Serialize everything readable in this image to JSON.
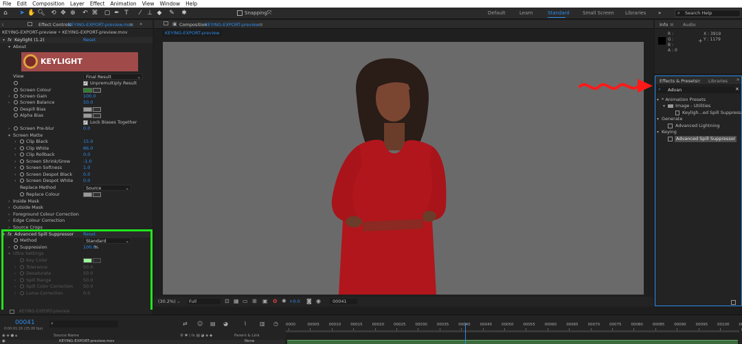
{
  "menu": [
    "File",
    "Edit",
    "Composition",
    "Layer",
    "Effect",
    "Animation",
    "View",
    "Window",
    "Help"
  ],
  "toolbar": {
    "snapping_label": "Snapping",
    "workspaces": [
      "Default",
      "Learn",
      "Standard",
      "Small Screen",
      "Libraries"
    ],
    "active_workspace": "Standard",
    "search_help_placeholder": "Search Help"
  },
  "effect_controls": {
    "tab_prefix": "Effect Controls",
    "tab_file": "KEYING-EXPORT-preview.mov",
    "breadcrumb": "KEYING-EXPORT-preview • KEYING-EXPORT-preview.mov",
    "keylight": {
      "name": "Keylight (1.2)",
      "reset": "Reset",
      "about": "About",
      "logo_text": "KEYLIGHT",
      "view_label": "View",
      "view_value": "Final Result",
      "unpremultiply": "Unpremultiply Result",
      "screen_colour": "Screen Colour",
      "screen_gain": {
        "label": "Screen Gain",
        "value": "100.0"
      },
      "screen_balance": {
        "label": "Screen Balance",
        "value": "50.0"
      },
      "despill_bias": "Despill Bias",
      "alpha_bias": "Alpha Bias",
      "lock_biases": "Lock Biases Together",
      "screen_preblur": {
        "label": "Screen Pre-blur",
        "value": "0.0"
      },
      "screen_matte": "Screen Matte",
      "matte_props": [
        {
          "label": "Clip Black",
          "value": "15.0"
        },
        {
          "label": "Clip White",
          "value": "86.0"
        },
        {
          "label": "Clip Rollback",
          "value": "0.0"
        },
        {
          "label": "Screen Shrink/Grow",
          "value": "-1.0"
        },
        {
          "label": "Screen Softness",
          "value": "1.0"
        },
        {
          "label": "Screen Despot Black",
          "value": "0.0"
        },
        {
          "label": "Screen Despot White",
          "value": "0.0"
        }
      ],
      "replace_method": {
        "label": "Replace Method",
        "value": "Source"
      },
      "replace_colour": "Replace Colour",
      "groups": [
        "Inside Mask",
        "Outside Mask",
        "Foreground Colour Correction",
        "Edge Colour Correction",
        "Source Crops"
      ]
    },
    "spill": {
      "name": "Advanced Spill Suppressor",
      "reset": "Reset",
      "method": {
        "label": "Method",
        "value": "Standard"
      },
      "suppression": {
        "label": "Suppression",
        "value": "100.0",
        "unit": "%"
      },
      "ultra_settings": "Ultra Settings",
      "ultra_props": [
        {
          "label": "Key Color",
          "value": ""
        },
        {
          "label": "Tolerance",
          "value": "50.0"
        },
        {
          "label": "Desaturate",
          "value": "50.0"
        },
        {
          "label": "Spill Range",
          "value": "50.0"
        },
        {
          "label": "Spill Color Correction",
          "value": "50.0"
        },
        {
          "label": "Luma Correction",
          "value": "0.0"
        }
      ]
    },
    "bottom_label": "KEYING-EXPORT-preview"
  },
  "composition": {
    "tab_prefix": "Composition",
    "tab_name": "KEYING-EXPORT-preview",
    "subtab": "KEYING-EXPORT-preview",
    "zoom": "(30.2%)",
    "resolution": "Full",
    "exposure": "+0.0",
    "frame": "00041"
  },
  "info": {
    "tabs": [
      "Info",
      "Audio"
    ],
    "r": "R :",
    "g": "G :",
    "b": "B :",
    "a": "A : 0",
    "x": "X : 3919",
    "y": "Y : 1179"
  },
  "effects_presets": {
    "tabs": [
      "Effects & Presets",
      "Libraries"
    ],
    "search_value": "Advan",
    "tree": [
      {
        "label": "* Animation Presets",
        "level": 0
      },
      {
        "label": "Image - Utilities",
        "level": 1
      },
      {
        "label": "Keyligh...ed Spill Suppressor",
        "level": 2
      },
      {
        "label": "Generate",
        "level": 0
      },
      {
        "label": "Advanced Lightning",
        "level": 2
      },
      {
        "label": "Keying",
        "level": 0
      },
      {
        "label": "Advanced Spill Suppressor",
        "level": 2
      }
    ]
  },
  "timeline": {
    "timecode": "00041",
    "sub_timecode": "0:00:01:16 (25.00 fps)",
    "source_name_header": "Source Name",
    "parent_header": "Parent & Link",
    "layer_name": "KEYING-EXPORT-preview.mov",
    "parent_value": "None",
    "ruler": [
      "0000",
      "00005",
      "00010",
      "00015",
      "00020",
      "00025",
      "00030",
      "00035",
      "00040",
      "00045",
      "00050",
      "00055",
      "00060",
      "00065",
      "00070",
      "00075",
      "00080",
      "00085",
      "00090",
      "00095",
      "00100",
      "00105"
    ],
    "playhead_frame": 41
  },
  "colors": {
    "accent": "#2d8ceb",
    "keylight_logo_bg": "#a04a4a",
    "screen_colour": "#2f7d2f",
    "key_color": "#9ef59a",
    "highlight_box": "#22e51c",
    "arrow": "#ff1a1a",
    "dress": "#b0161c"
  }
}
